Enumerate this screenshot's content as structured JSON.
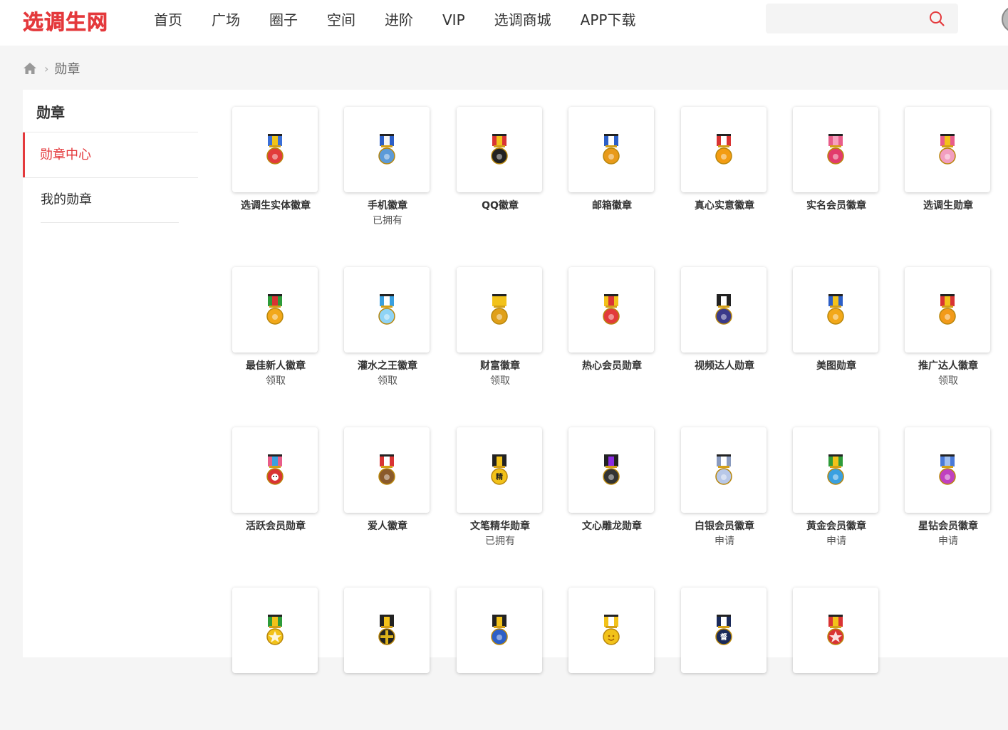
{
  "header": {
    "logo": "选调生网",
    "nav": [
      "首页",
      "广场",
      "圈子",
      "空间",
      "进阶",
      "VIP",
      "选调商城",
      "APP下载"
    ],
    "search": {
      "placeholder": "",
      "value": ""
    }
  },
  "breadcrumb": {
    "current": "勋章"
  },
  "sidebar": {
    "title": "勋章",
    "items": [
      {
        "label": "勋章中心",
        "active": true
      },
      {
        "label": "我的勋章",
        "active": false
      }
    ]
  },
  "badges": [
    {
      "name": "选调生实体徽章",
      "status": "",
      "ribbon": [
        "#3a6fd8",
        "#f0c419",
        "#3a6fd8"
      ],
      "medal": "#e23b3b",
      "icon": "circle-medal"
    },
    {
      "name": "手机徽章",
      "status": "已拥有",
      "ribbon": [
        "#2c5fc7",
        "#f5f5f5",
        "#2c5fc7"
      ],
      "medal": "#5c9ad8",
      "icon": "phone"
    },
    {
      "name": "QQ徽章",
      "status": "",
      "ribbon": [
        "#d93434",
        "#f2c21a",
        "#d93434"
      ],
      "medal": "#222",
      "icon": "penguin"
    },
    {
      "name": "邮箱徽章",
      "status": "",
      "ribbon": [
        "#2c5fc7",
        "#ffffff",
        "#2c5fc7"
      ],
      "medal": "#e89a1a",
      "icon": "sun"
    },
    {
      "name": "真心实意徽章",
      "status": "",
      "ribbon": [
        "#d93434",
        "#ffffff",
        "#d93434"
      ],
      "medal": "#f39c12",
      "icon": "circle-medal"
    },
    {
      "name": "实名会员徽章",
      "status": "",
      "ribbon": [
        "#e85d8a",
        "#f7a1be",
        "#e85d8a"
      ],
      "medal": "#e23b6b",
      "icon": "flower"
    },
    {
      "name": "选调生勋章",
      "status": "",
      "ribbon": [
        "#e85d8a",
        "#f2c21a",
        "#e85d8a"
      ],
      "medal": "#f29ec0",
      "icon": "flower"
    },
    {
      "name": "最佳新人徽章",
      "status": "领取",
      "ribbon": [
        "#2e9b3a",
        "#d93434",
        "#2e9b3a"
      ],
      "medal": "#f2a81a",
      "icon": "circle-medal"
    },
    {
      "name": "灌水之王徽章",
      "status": "领取",
      "ribbon": [
        "#3aa0e0",
        "#ffffff",
        "#3aa0e0"
      ],
      "medal": "#8fd3f5",
      "icon": "bowl"
    },
    {
      "name": "财富徽章",
      "status": "领取",
      "ribbon": [
        "#f2c21a",
        "#f2c21a",
        "#f2c21a"
      ],
      "medal": "#e0a01a",
      "icon": "coins"
    },
    {
      "name": "热心会员勋章",
      "status": "",
      "ribbon": [
        "#f2c21a",
        "#d93434",
        "#f2c21a"
      ],
      "medal": "#e23b3b",
      "icon": "sun"
    },
    {
      "name": "视频达人勋章",
      "status": "",
      "ribbon": [
        "#222222",
        "#ffffff",
        "#222222"
      ],
      "medal": "#3a3a8a",
      "icon": "film"
    },
    {
      "name": "美图勋章",
      "status": "",
      "ribbon": [
        "#2c5fc7",
        "#f2c21a",
        "#2c5fc7"
      ],
      "medal": "#f2a81a",
      "icon": "sun"
    },
    {
      "name": "推广达人徽章",
      "status": "领取",
      "ribbon": [
        "#d93434",
        "#f2c21a",
        "#d93434"
      ],
      "medal": "#f29a1a",
      "icon": "sun"
    },
    {
      "name": "活跃会员勋章",
      "status": "",
      "ribbon": [
        "#e85d8a",
        "#3aa0e0",
        "#e85d8a"
      ],
      "medal": "#d93434",
      "icon": "face"
    },
    {
      "name": "爱人徽章",
      "status": "",
      "ribbon": [
        "#d93434",
        "#ffffff",
        "#d93434"
      ],
      "medal": "#8a5a2b",
      "icon": "couple"
    },
    {
      "name": "文笔精华勋章",
      "status": "已拥有",
      "ribbon": [
        "#222222",
        "#f2c21a",
        "#222222"
      ],
      "medal": "#f2c21a",
      "icon": "text-jing"
    },
    {
      "name": "文心雕龙勋章",
      "status": "",
      "ribbon": [
        "#222222",
        "#8a2be2",
        "#222222"
      ],
      "medal": "#333333",
      "icon": "dragon"
    },
    {
      "name": "白银会员徽章",
      "status": "申请",
      "ribbon": [
        "#8a9bbf",
        "#ffffff",
        "#8a9bbf"
      ],
      "medal": "#b8c8e8",
      "icon": "wing"
    },
    {
      "name": "黄金会员徽章",
      "status": "申请",
      "ribbon": [
        "#2e9b3a",
        "#f2c21a",
        "#2e9b3a"
      ],
      "medal": "#3aa0e0",
      "icon": "gems"
    },
    {
      "name": "星钻会员徽章",
      "status": "申请",
      "ribbon": [
        "#4a7ad8",
        "#a0c0f0",
        "#4a7ad8"
      ],
      "medal": "#c040c0",
      "icon": "gems"
    },
    {
      "name": "",
      "status": "",
      "ribbon": [
        "#2e9b3a",
        "#f2c21a",
        "#2e9b3a"
      ],
      "medal": "#f2c21a",
      "icon": "star"
    },
    {
      "name": "",
      "status": "",
      "ribbon": [
        "#222222",
        "#f2c21a",
        "#222222"
      ],
      "medal": "#222222",
      "icon": "cross"
    },
    {
      "name": "",
      "status": "",
      "ribbon": [
        "#222222",
        "#f2c21a",
        "#222222"
      ],
      "medal": "#2c5fc7",
      "icon": "circle-medal"
    },
    {
      "name": "",
      "status": "",
      "ribbon": [
        "#f2c21a",
        "#ffffff",
        "#f2c21a"
      ],
      "medal": "#f2c21a",
      "icon": "smile"
    },
    {
      "name": "",
      "status": "",
      "ribbon": [
        "#1a2a5a",
        "#ffffff",
        "#1a2a5a"
      ],
      "medal": "#1a2a5a",
      "icon": "text-du"
    },
    {
      "name": "",
      "status": "",
      "ribbon": [
        "#d93434",
        "#f2c21a",
        "#d93434"
      ],
      "medal": "#d93434",
      "icon": "star"
    }
  ]
}
